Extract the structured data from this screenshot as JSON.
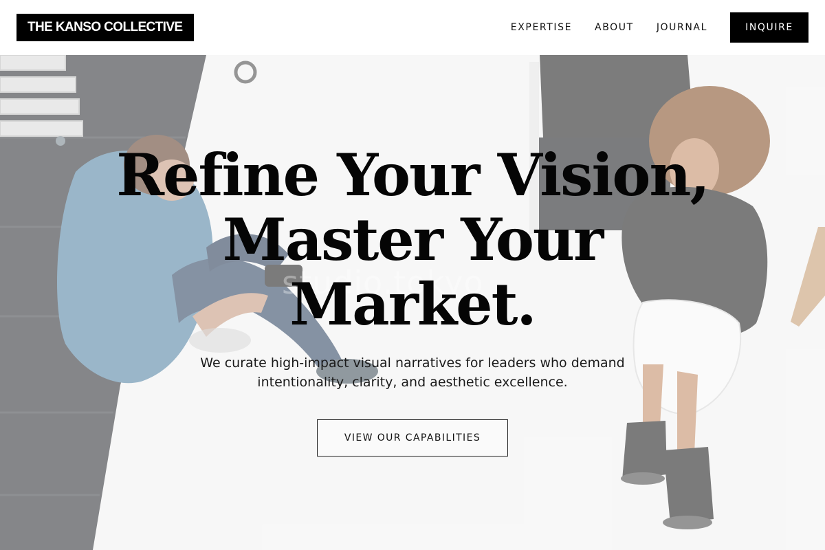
{
  "header": {
    "logo_text": "THE KANSO COLLECTIVE",
    "nav": [
      {
        "label": "EXPERTISE"
      },
      {
        "label": "ABOUT"
      },
      {
        "label": "JOURNAL"
      }
    ],
    "inquire_label": "INQUIRE"
  },
  "hero": {
    "title_lines": [
      "Refine Your Vision,",
      "Master Your",
      "Market."
    ],
    "subtitle": "We curate high-impact visual narratives for leaders who demand intentionality, clarity, and aesthetic excellence.",
    "cta_label": "VIEW OUR CAPABILITIES",
    "background_image": "studio photo of two people seated on a white floor",
    "watermark": "studio.tokyo"
  },
  "colors": {
    "ink": "#000000",
    "header_bg": "#ffffff",
    "text": "#111111"
  }
}
